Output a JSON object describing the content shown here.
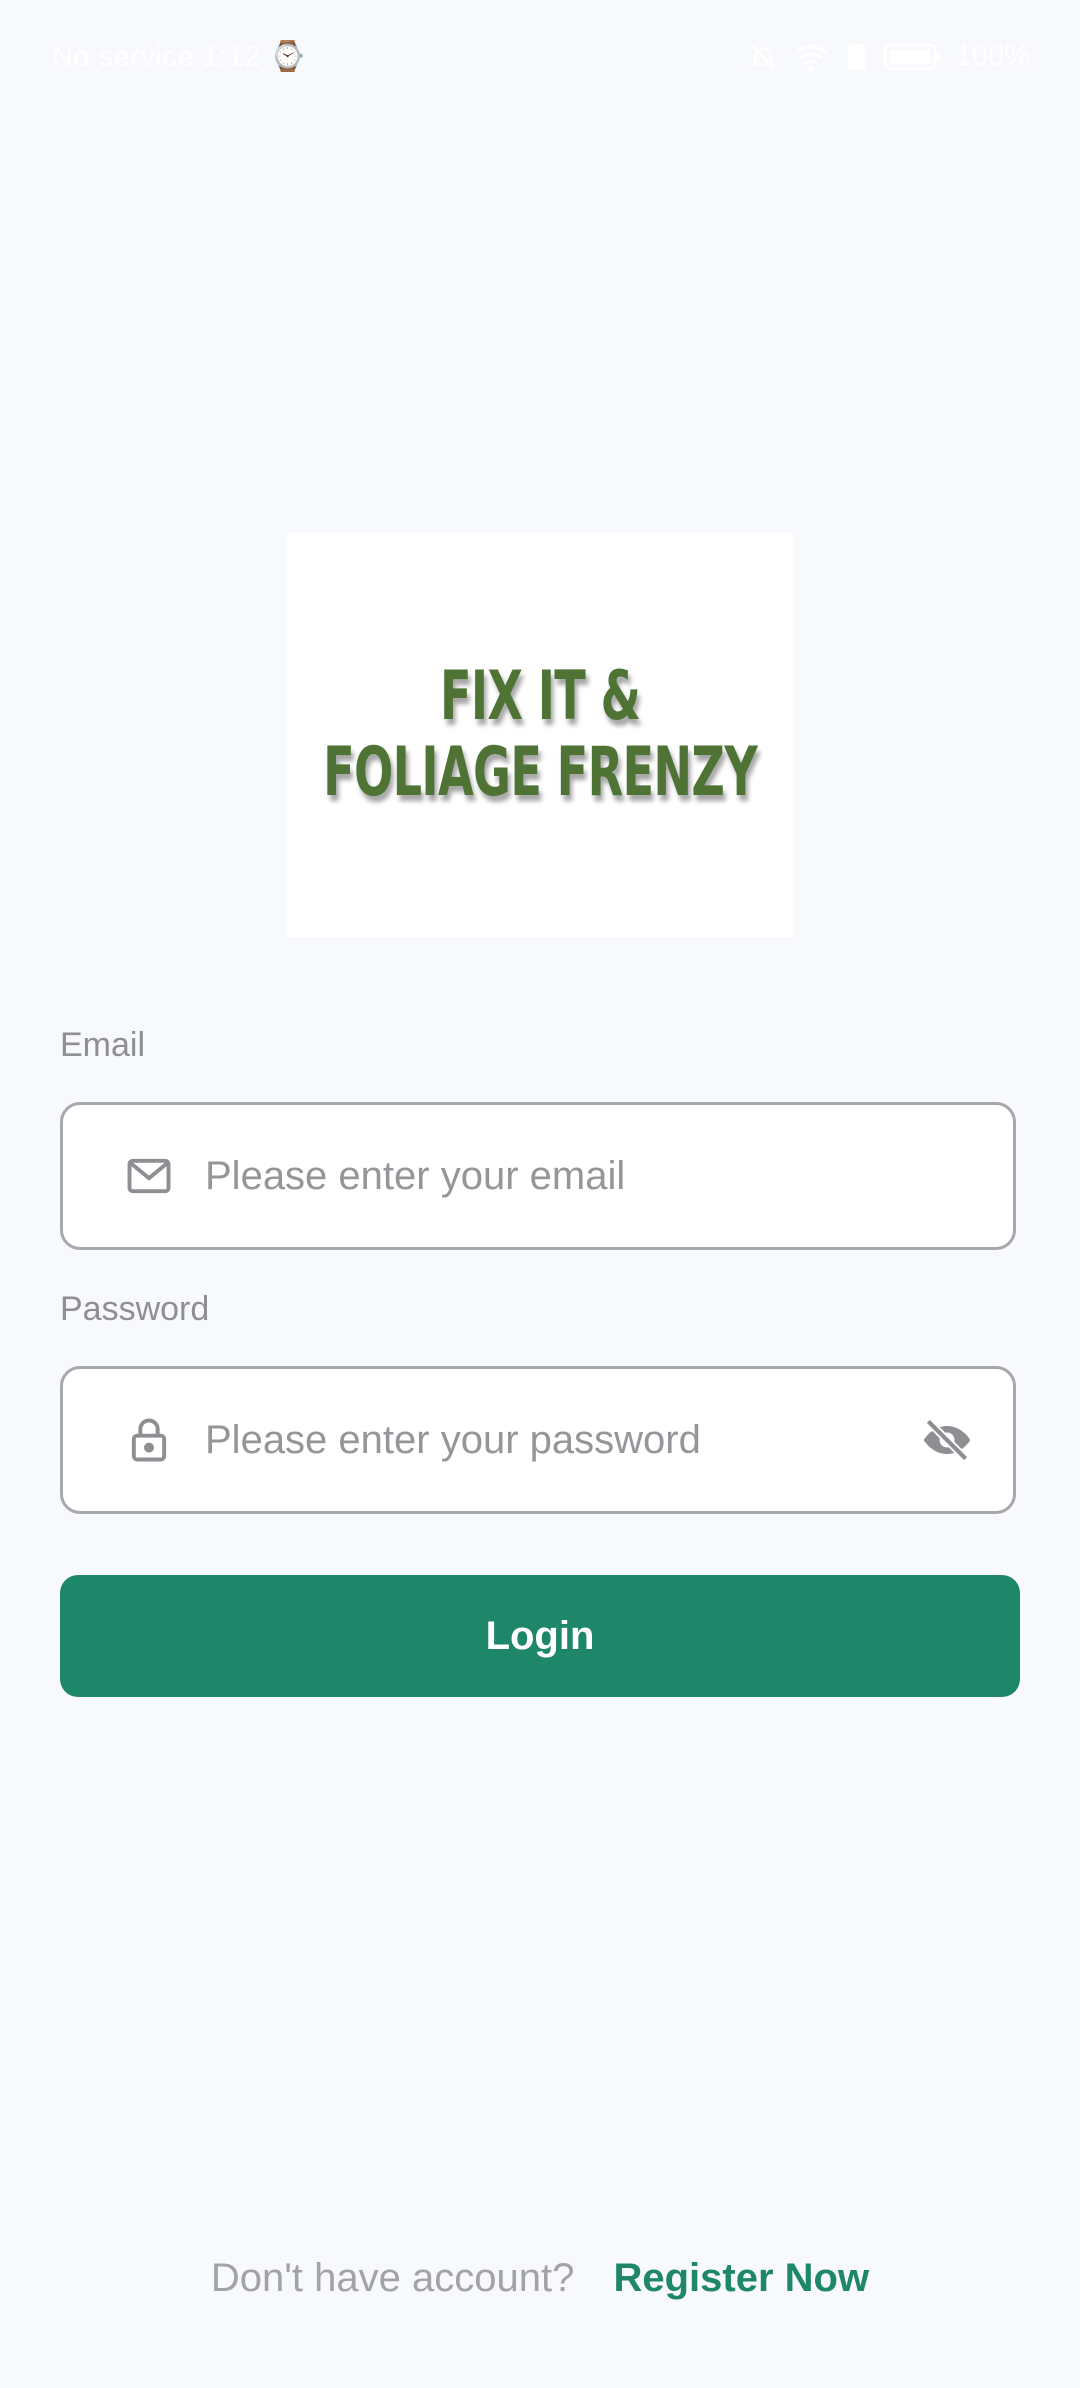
{
  "status_bar": {
    "left_text": "No service 1:12 ⌚",
    "battery_text": "100%"
  },
  "logo": {
    "line1": "FIX IT &",
    "line2": "FOLIAGE FRENZY"
  },
  "form": {
    "email_label": "Email",
    "email_placeholder": "Please enter your email",
    "password_label": "Password",
    "password_placeholder": "Please enter your password",
    "login_label": "Login"
  },
  "footer": {
    "prompt": "Don't have account?",
    "register_label": "Register Now"
  },
  "colors": {
    "accent": "#1f8769",
    "logo_green": "#4e7335",
    "background": "#f8f9fc"
  },
  "icons": {
    "email": "mail-icon",
    "password": "lock-icon",
    "toggle": "eye-off-icon"
  }
}
